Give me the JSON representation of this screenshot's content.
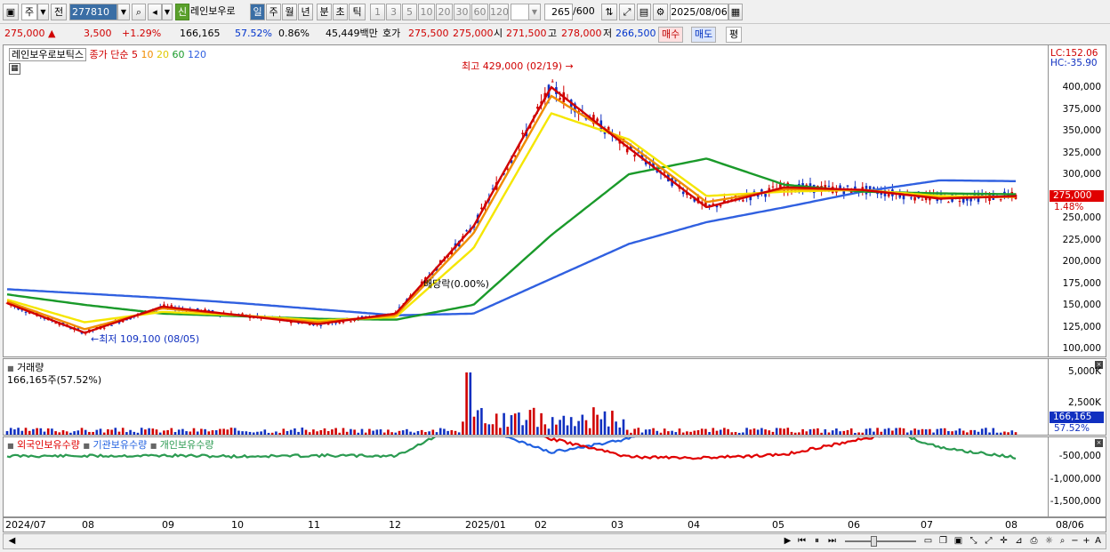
{
  "toolbar": {
    "period_label": "주",
    "prev_label": "전",
    "code": "277810",
    "new_badge": "신",
    "stock_name": "레인보우로",
    "periods": [
      "일",
      "주",
      "월",
      "년",
      "분",
      "초",
      "틱"
    ],
    "intervals": [
      "1",
      "3",
      "5",
      "10",
      "20",
      "30",
      "60",
      "120"
    ],
    "count_value": "265",
    "count_total": "/600",
    "date": "2025/08/06"
  },
  "quote": {
    "price": "275,000",
    "change": "3,500",
    "change_pct": "+1.29%",
    "volume": "166,165",
    "turnover_pct": "57.52%",
    "ratio": "0.86%",
    "amount": "45,449백만",
    "bid_label": "호가",
    "bid1": "275,500",
    "bid2": "275,000",
    "open_label": "시",
    "open": "271,500",
    "high_label": "고",
    "high": "278,000",
    "low_label": "저",
    "low": "266,500",
    "buy_label": "매수",
    "sell_label": "매도",
    "eval_label": "평"
  },
  "price_pane": {
    "legend_name": "레인보우로보틱스",
    "legend_ma": "종가 단순",
    "ma_periods": [
      "5",
      "10",
      "20",
      "60",
      "120"
    ],
    "high_annotation": "최고 429,000 (02/19)",
    "low_annotation": "최저 109,100 (08/05)",
    "dividend_annotation": "배당락(0.00%)",
    "lc": "LC:152.06",
    "hc": "HC:-35.90",
    "price_marker": "275,000",
    "pct_marker": "1.48%",
    "ticks": [
      "400,000",
      "375,000",
      "350,000",
      "325,000",
      "300,000",
      "275,000",
      "250,000",
      "225,000",
      "200,000",
      "175,000",
      "150,000",
      "125,000",
      "100,000"
    ]
  },
  "volume_pane": {
    "title": "거래량",
    "summary": "166,165주(57.52%)",
    "ticks": [
      "5,000K",
      "2,500K"
    ],
    "marker": "166,165",
    "marker_pct": "57.52%"
  },
  "holding_pane": {
    "legend": [
      "외국인보유수량",
      "기관보유수량",
      "개인보유수량"
    ],
    "ticks": [
      "-500,000",
      "-1,000,000",
      "-1,500,000"
    ]
  },
  "x_axis": [
    "2024/07",
    "08",
    "09",
    "10",
    "11",
    "12",
    "2025/01",
    "02",
    "03",
    "04",
    "05",
    "06",
    "07",
    "08",
    "08/06"
  ],
  "colors": {
    "ma5": "#d00000",
    "ma10": "#f08c00",
    "ma20": "#f5e600",
    "ma60": "#1a9a2a",
    "ma120": "#3060e0",
    "up": "#d00000",
    "down": "#1030c0",
    "foreign": "#e00000",
    "inst": "#2060e0",
    "indiv": "#2a9a50"
  },
  "chart_data": {
    "type": "line",
    "x": [
      "2024/07",
      "2024/08",
      "2024/09",
      "2024/10",
      "2024/11",
      "2024/12",
      "2025/01",
      "2025/02",
      "2025/03",
      "2025/04",
      "2025/05",
      "2025/06",
      "2025/07",
      "2025/08"
    ],
    "series": [
      {
        "name": "5",
        "values": [
          152000,
          118000,
          148000,
          138000,
          128000,
          140000,
          240000,
          400000,
          330000,
          262000,
          285000,
          282000,
          272000,
          275000
        ]
      },
      {
        "name": "10",
        "values": [
          154000,
          122000,
          146000,
          138000,
          130000,
          138000,
          232000,
          390000,
          335000,
          268000,
          283000,
          282000,
          273000,
          274000
        ]
      },
      {
        "name": "20",
        "values": [
          156000,
          130000,
          142000,
          138000,
          132000,
          136000,
          215000,
          370000,
          340000,
          275000,
          280000,
          282000,
          275000,
          274000
        ]
      },
      {
        "name": "60",
        "values": [
          162000,
          150000,
          140000,
          137000,
          134000,
          133000,
          150000,
          230000,
          300000,
          318000,
          288000,
          280000,
          278000,
          277000
        ]
      },
      {
        "name": "120",
        "values": [
          168000,
          163000,
          158000,
          152000,
          145000,
          138000,
          140000,
          180000,
          220000,
          245000,
          262000,
          280000,
          293000,
          292000
        ]
      }
    ],
    "ylim": [
      100000,
      430000
    ]
  }
}
